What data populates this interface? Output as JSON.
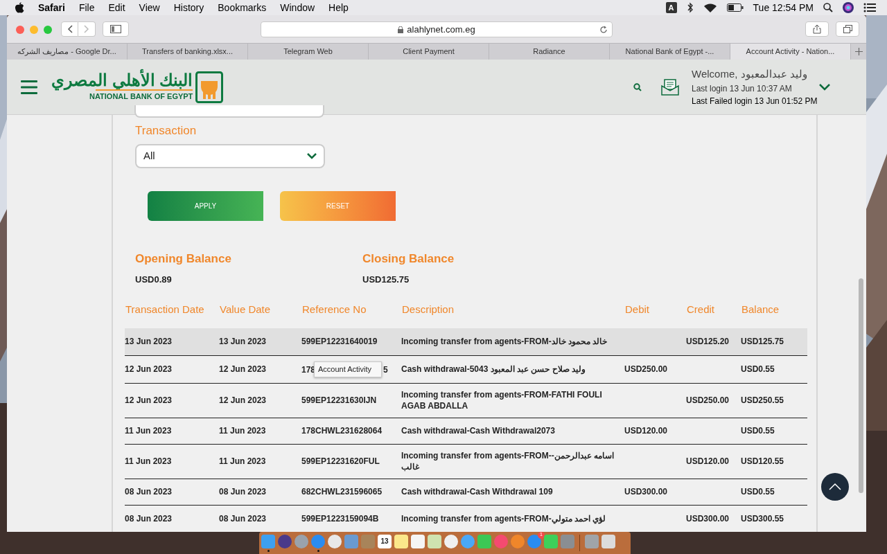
{
  "menu_bar": {
    "app": "Safari",
    "menus": [
      "File",
      "Edit",
      "View",
      "History",
      "Bookmarks",
      "Window",
      "Help"
    ],
    "input_source": "A",
    "clock": "Tue 12:54 PM"
  },
  "toolbar": {
    "url": "alahlynet.com.eg"
  },
  "tabs": [
    {
      "label": "مصاريف الشركه - Google Dr...",
      "selected": false
    },
    {
      "label": "Transfers of banking.xlsx...",
      "selected": false
    },
    {
      "label": "Telegram Web",
      "selected": false
    },
    {
      "label": "Client Payment",
      "selected": false
    },
    {
      "label": "Radiance",
      "selected": false
    },
    {
      "label": "National Bank of Egypt -...",
      "selected": false
    },
    {
      "label": "Account Activity - Nation...",
      "selected": true
    }
  ],
  "header": {
    "logo_arabic": "البنك الأهلي المصري",
    "logo_english": "NATIONAL BANK OF EGYPT",
    "welcome": "Welcome, وليد عبدالمعبود",
    "last_login": "Last login 13 Jun 10:37 AM",
    "last_failed_login": "Last Failed login 13 Jun 01:52 PM"
  },
  "filter": {
    "label": "Transaction",
    "value": "All",
    "buttons": [
      "APPLY",
      "RESET"
    ]
  },
  "balances": [
    {
      "label": "Opening Balance",
      "value": "USD0.89"
    },
    {
      "label": "Closing Balance",
      "value": "USD125.75"
    }
  ],
  "table": {
    "columns": [
      "Transaction Date",
      "Value Date",
      "Reference No",
      "Description",
      "Debit",
      "Credit",
      "Balance"
    ],
    "rows": [
      {
        "cells": [
          "13 Jun 2023",
          "13 Jun 2023",
          "599EP12231640019",
          "Incoming transfer from agents-FROM-خالد محمود خالد",
          "",
          "USD125.20",
          "USD125.75"
        ],
        "selected": true
      },
      {
        "cells": [
          "12 Jun 2023",
          "12 Jun 2023",
          "178",
          "Cash withdrawal-5043 وليد صلاح حسن عبد المعبود",
          "USD250.00",
          "",
          "USD0.55"
        ],
        "selected": false,
        "reference_tail": "5"
      },
      {
        "cells": [
          "12 Jun 2023",
          "12 Jun 2023",
          "599EP12231630IJN",
          "Incoming transfer from agents-FROM-FATHI FOULI AGAB ABDALLA",
          "",
          "USD250.00",
          "USD250.55"
        ],
        "selected": false
      },
      {
        "cells": [
          "11 Jun 2023",
          "11 Jun 2023",
          "178CHWL231628064",
          "Cash withdrawal-Cash Withdrawal2073",
          "USD120.00",
          "",
          "USD0.55"
        ],
        "selected": false
      },
      {
        "cells": [
          "11 Jun 2023",
          "11 Jun 2023",
          "599EP12231620FUL",
          "Incoming transfer from agents-FROM-اسامه عبدالرحمن- غالب",
          "",
          "USD120.00",
          "USD120.55"
        ],
        "selected": false
      },
      {
        "cells": [
          "08 Jun 2023",
          "08 Jun 2023",
          "682CHWL231596065",
          "Cash withdrawal-Cash Withdrawal 109",
          "USD300.00",
          "",
          "USD0.55"
        ],
        "selected": false
      },
      {
        "cells": [
          "08 Jun 2023",
          "08 Jun 2023",
          "599EP1223159094B",
          "Incoming transfer from agents-FROM-لؤي احمد متولي",
          "",
          "USD300.00",
          "USD300.55"
        ],
        "selected": false
      }
    ]
  },
  "tooltip": "Account Activity",
  "dock": {
    "items": [
      {
        "kind": "finder",
        "running": true
      },
      {
        "kind": "siri",
        "running": false
      },
      {
        "kind": "launchpad",
        "running": false
      },
      {
        "kind": "safari",
        "running": true
      },
      {
        "kind": "chrome",
        "running": false
      },
      {
        "kind": "preview",
        "running": false
      },
      {
        "kind": "contacts",
        "running": false
      },
      {
        "kind": "calendar",
        "running": false,
        "text": "13"
      },
      {
        "kind": "notes",
        "running": false
      },
      {
        "kind": "reminders",
        "running": false
      },
      {
        "kind": "maps",
        "running": false
      },
      {
        "kind": "photos",
        "running": false
      },
      {
        "kind": "messages",
        "running": false
      },
      {
        "kind": "facetime",
        "running": false
      },
      {
        "kind": "music",
        "running": false
      },
      {
        "kind": "books",
        "running": false
      },
      {
        "kind": "appstore",
        "running": false,
        "badge": "1"
      },
      {
        "kind": "whatsapp",
        "running": false
      },
      {
        "kind": "settings",
        "running": false
      },
      {
        "kind": "separator"
      },
      {
        "kind": "drive",
        "running": false
      },
      {
        "kind": "trash",
        "running": false
      }
    ]
  }
}
